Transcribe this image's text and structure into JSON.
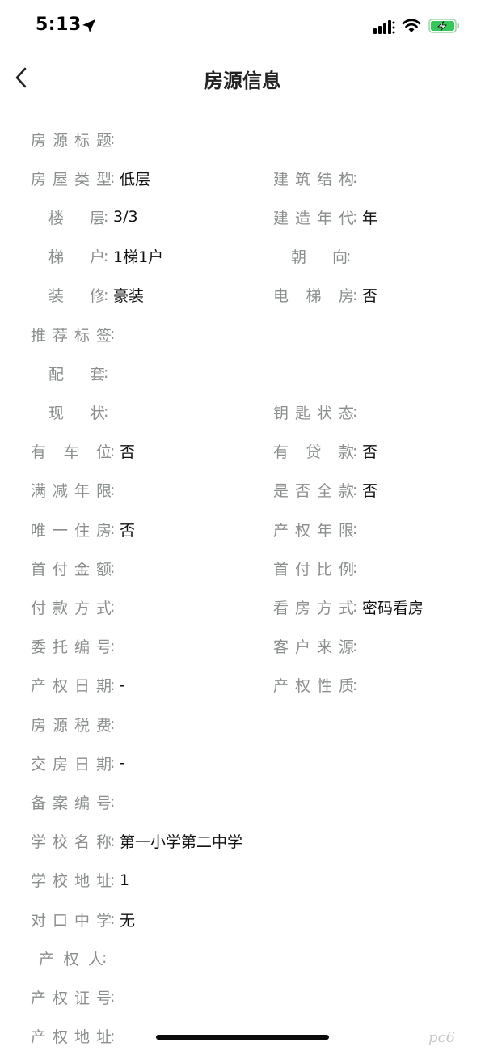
{
  "status_bar": {
    "time": "5:13",
    "icons": [
      "location-arrow-icon",
      "cellular-signal-icon",
      "wifi-icon",
      "battery-charging-icon"
    ],
    "battery_color": "#34c759"
  },
  "nav": {
    "title": "房源信息",
    "back_icon": "chevron-left-icon"
  },
  "colors": {
    "label": "#8a8f8c",
    "value": "#111111",
    "background": "#ffffff"
  },
  "rows": [
    {
      "left": {
        "label": "房源标题",
        "value": ""
      }
    },
    {
      "left": {
        "label": "房屋类型",
        "value": "低层"
      },
      "right": {
        "label": "建筑结构",
        "value": ""
      }
    },
    {
      "left": {
        "label": "楼　层",
        "value": "3/3"
      },
      "right": {
        "label": "建造年代",
        "value": "年"
      }
    },
    {
      "left": {
        "label": "梯　户",
        "value": "1梯1户"
      },
      "right": {
        "label": "朝　向",
        "value": ""
      }
    },
    {
      "left": {
        "label": "装　修",
        "value": "豪装"
      },
      "right": {
        "label": "电 梯 房",
        "value": "否"
      }
    },
    {
      "left": {
        "label": "推荐标签",
        "value": ""
      }
    },
    {
      "left": {
        "label": "配　套",
        "value": ""
      }
    },
    {
      "left": {
        "label": "现　状",
        "value": ""
      },
      "right": {
        "label": "钥匙状态",
        "value": ""
      }
    },
    {
      "left": {
        "label": "有 车 位",
        "value": "否"
      },
      "right": {
        "label": "有 贷 款",
        "value": "否"
      }
    },
    {
      "left": {
        "label": "满减年限",
        "value": ""
      },
      "right": {
        "label": "是否全款",
        "value": "否"
      }
    },
    {
      "left": {
        "label": "唯一住房",
        "value": "否"
      },
      "right": {
        "label": "产权年限",
        "value": ""
      }
    },
    {
      "left": {
        "label": "首付金额",
        "value": ""
      },
      "right": {
        "label": "首付比例",
        "value": ""
      }
    },
    {
      "left": {
        "label": "付款方式",
        "value": ""
      },
      "right": {
        "label": "看房方式",
        "value": "密码看房"
      }
    },
    {
      "left": {
        "label": "委托编号",
        "value": ""
      },
      "right": {
        "label": "客户来源",
        "value": ""
      }
    },
    {
      "left": {
        "label": "产权日期",
        "value": "-"
      },
      "right": {
        "label": "产权性质",
        "value": ""
      }
    },
    {
      "left": {
        "label": "房源税费",
        "value": ""
      }
    },
    {
      "left": {
        "label": "交房日期",
        "value": "-"
      }
    },
    {
      "left": {
        "label": "备案编号",
        "value": ""
      }
    },
    {
      "left": {
        "label": "学校名称",
        "value": "第一小学第二中学"
      }
    },
    {
      "left": {
        "label": "学校地址",
        "value": "1"
      }
    },
    {
      "left": {
        "label": "对口中学",
        "value": "无"
      }
    },
    {
      "left": {
        "label": "产权人",
        "value": ""
      }
    },
    {
      "left": {
        "label": "产权证号",
        "value": ""
      }
    },
    {
      "left": {
        "label": "产权地址",
        "value": ""
      }
    }
  ],
  "colon": ":",
  "watermark": "pc6"
}
